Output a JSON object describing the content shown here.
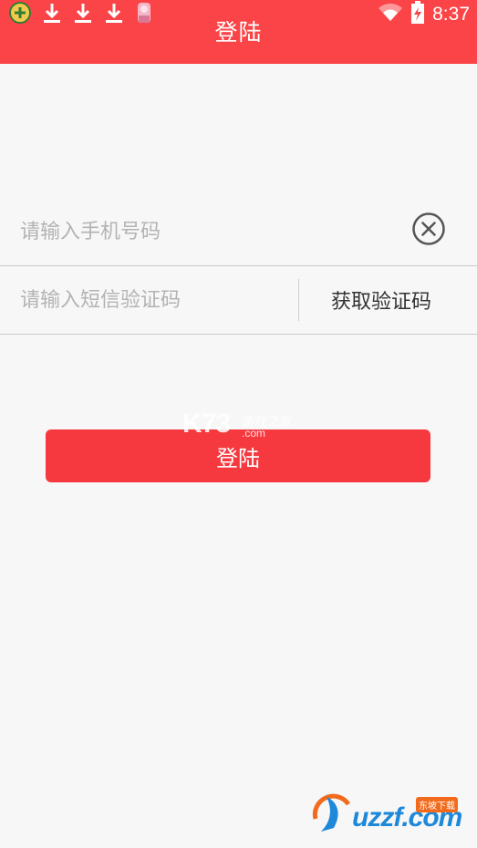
{
  "status_bar": {
    "time": "8:37",
    "left_icons": [
      "app-icon",
      "download-icon",
      "download-icon",
      "download-icon",
      "avatar-icon"
    ],
    "right_icons": [
      "wifi-icon",
      "battery-charging-icon"
    ]
  },
  "header": {
    "title": "登陆",
    "background": "#fb4447"
  },
  "form": {
    "phone_placeholder": "请输入手机号码",
    "code_placeholder": "请输入短信验证码",
    "get_code_label": "获取验证码"
  },
  "login_button": {
    "label": "登陆",
    "color": "#f5393f"
  },
  "watermarks": {
    "k73_logo": "K73",
    "k73_sub": "游戏之家",
    "k73_com": ".com",
    "uzzf_logo": "uzzf.com",
    "uzzf_badge": "东坡下载"
  }
}
